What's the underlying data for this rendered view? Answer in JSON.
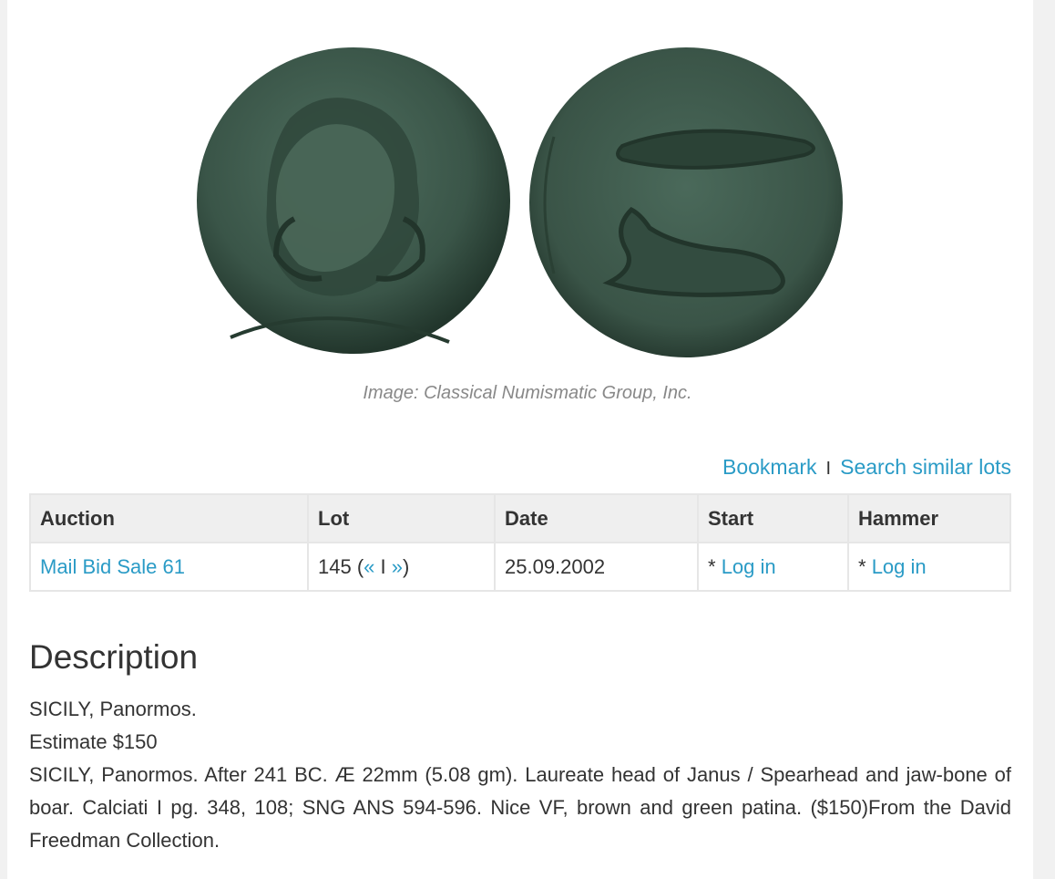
{
  "image": {
    "caption": "Image: Classical Numismatic Group, Inc.",
    "obverse_icon": "coin-obverse-janus-head",
    "reverse_icon": "coin-reverse-spearhead-jawbone",
    "coin_color": "#3d5a4c"
  },
  "actions": {
    "bookmark": "Bookmark",
    "separator": "I",
    "search_similar": "Search similar lots"
  },
  "table": {
    "headers": [
      "Auction",
      "Lot",
      "Date",
      "Start",
      "Hammer"
    ],
    "row": {
      "auction": "Mail Bid Sale 61",
      "lot_number": "145 (",
      "lot_prev": "«",
      "lot_sep": " I ",
      "lot_next": "»",
      "lot_close": ")",
      "date": "25.09.2002",
      "start_prefix": "* ",
      "start_link": "Log in",
      "hammer_prefix": "* ",
      "hammer_link": "Log in"
    }
  },
  "description": {
    "heading": "Description",
    "line1": "SICILY, Panormos.",
    "line2": "Estimate $150",
    "body": "SICILY, Panormos. After 241 BC. Æ 22mm (5.08 gm). Laureate head of Janus / Spearhead and jaw-bone of boar. Calciati I pg. 348, 108; SNG ANS 594-596. Nice VF, brown and green patina. ($150)From the David Freedman Collection."
  },
  "colors": {
    "link": "#2a9bc6",
    "table_header_bg": "#efefef"
  }
}
